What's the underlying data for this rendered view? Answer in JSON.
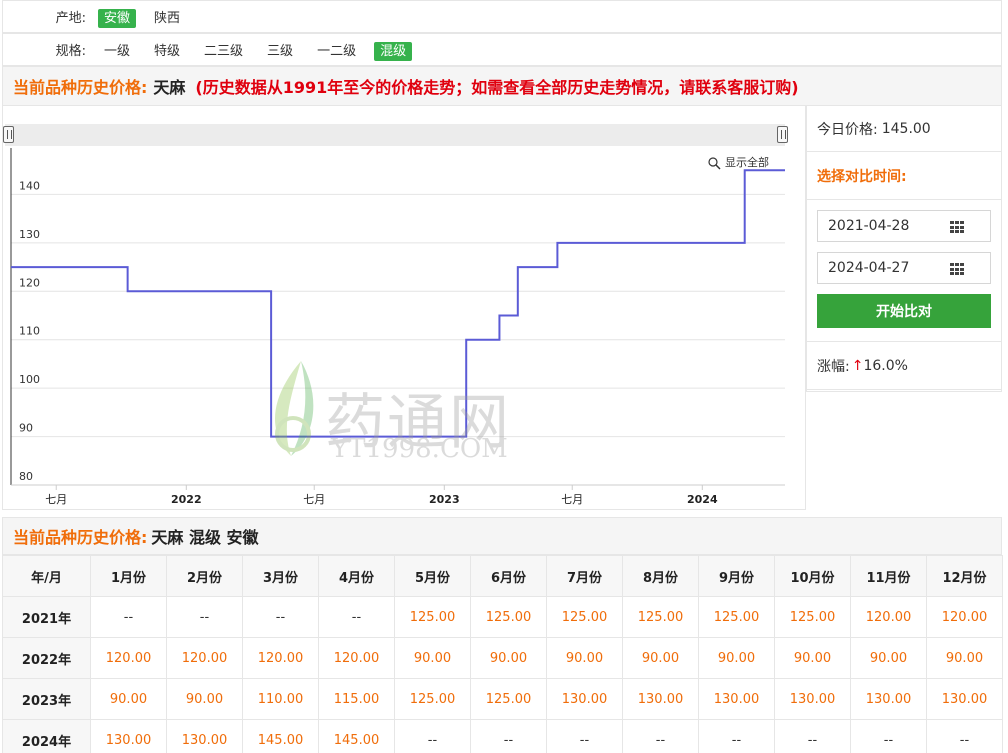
{
  "filters": {
    "origin_label": "产地:",
    "origins": [
      "安徽",
      "陕西"
    ],
    "origin_selected": 0,
    "spec_label": "规格:",
    "specs": [
      "一级",
      "特级",
      "二三级",
      "三级",
      "一二级",
      "混级"
    ],
    "spec_selected": 5
  },
  "price_header": {
    "label": "当前品种历史价格:",
    "name": "天麻",
    "note": "(历史数据从1991年至今的价格走势；如需查看全部历史走势情况，请联系客服订购)"
  },
  "chart_data": {
    "type": "line",
    "step": true,
    "show_all_label": "显示全部",
    "ylim": [
      80,
      150
    ],
    "y_ticks": [
      80,
      90,
      100,
      110,
      120,
      130,
      140
    ],
    "x_ticks": [
      {
        "label": "七月",
        "date": "2021-07-01",
        "bold": false
      },
      {
        "label": "2022",
        "date": "2022-01-01",
        "bold": true
      },
      {
        "label": "七月",
        "date": "2022-07-01",
        "bold": false
      },
      {
        "label": "2023",
        "date": "2023-01-01",
        "bold": true
      },
      {
        "label": "七月",
        "date": "2023-07-01",
        "bold": false
      },
      {
        "label": "2024",
        "date": "2024-01-01",
        "bold": true
      }
    ],
    "x_range": [
      "2021-04-28",
      "2024-04-27"
    ],
    "color": "#5b5bd6",
    "series": [
      {
        "points": [
          [
            "2021-04-28",
            125
          ],
          [
            "2021-10-10",
            120
          ],
          [
            "2022-05-01",
            90
          ],
          [
            "2023-02-01",
            110
          ],
          [
            "2023-03-20",
            115
          ],
          [
            "2023-04-15",
            125
          ],
          [
            "2023-06-10",
            130
          ],
          [
            "2024-03-01",
            145
          ],
          [
            "2024-04-27",
            145
          ]
        ]
      }
    ]
  },
  "watermark": {
    "cn": "药通网",
    "en": "YT1998.COM"
  },
  "side": {
    "today_label": "今日价格:",
    "today_value": "145.00",
    "compare_title": "选择对比时间:",
    "date_from": "2021-04-28",
    "date_to": "2024-04-27",
    "compare_button": "开始比对",
    "rise_label": "涨幅:",
    "rise_arrow": "↑",
    "rise_value": "16.0%"
  },
  "history": {
    "label": "当前品种历史价格:",
    "name": "天麻 混级 安徽",
    "columns": [
      "年/月",
      "1月份",
      "2月份",
      "3月份",
      "4月份",
      "5月份",
      "6月份",
      "7月份",
      "8月份",
      "9月份",
      "10月份",
      "11月份",
      "12月份"
    ],
    "rows": [
      {
        "year": "2021年",
        "values": [
          "--",
          "--",
          "--",
          "--",
          "125.00",
          "125.00",
          "125.00",
          "125.00",
          "125.00",
          "125.00",
          "120.00",
          "120.00"
        ]
      },
      {
        "year": "2022年",
        "values": [
          "120.00",
          "120.00",
          "120.00",
          "120.00",
          "90.00",
          "90.00",
          "90.00",
          "90.00",
          "90.00",
          "90.00",
          "90.00",
          "90.00"
        ]
      },
      {
        "year": "2023年",
        "values": [
          "90.00",
          "90.00",
          "110.00",
          "115.00",
          "125.00",
          "125.00",
          "130.00",
          "130.00",
          "130.00",
          "130.00",
          "130.00",
          "130.00"
        ]
      },
      {
        "year": "2024年",
        "values": [
          "130.00",
          "130.00",
          "145.00",
          "145.00",
          "--",
          "--",
          "--",
          "--",
          "--",
          "--",
          "--",
          "--"
        ]
      }
    ]
  }
}
